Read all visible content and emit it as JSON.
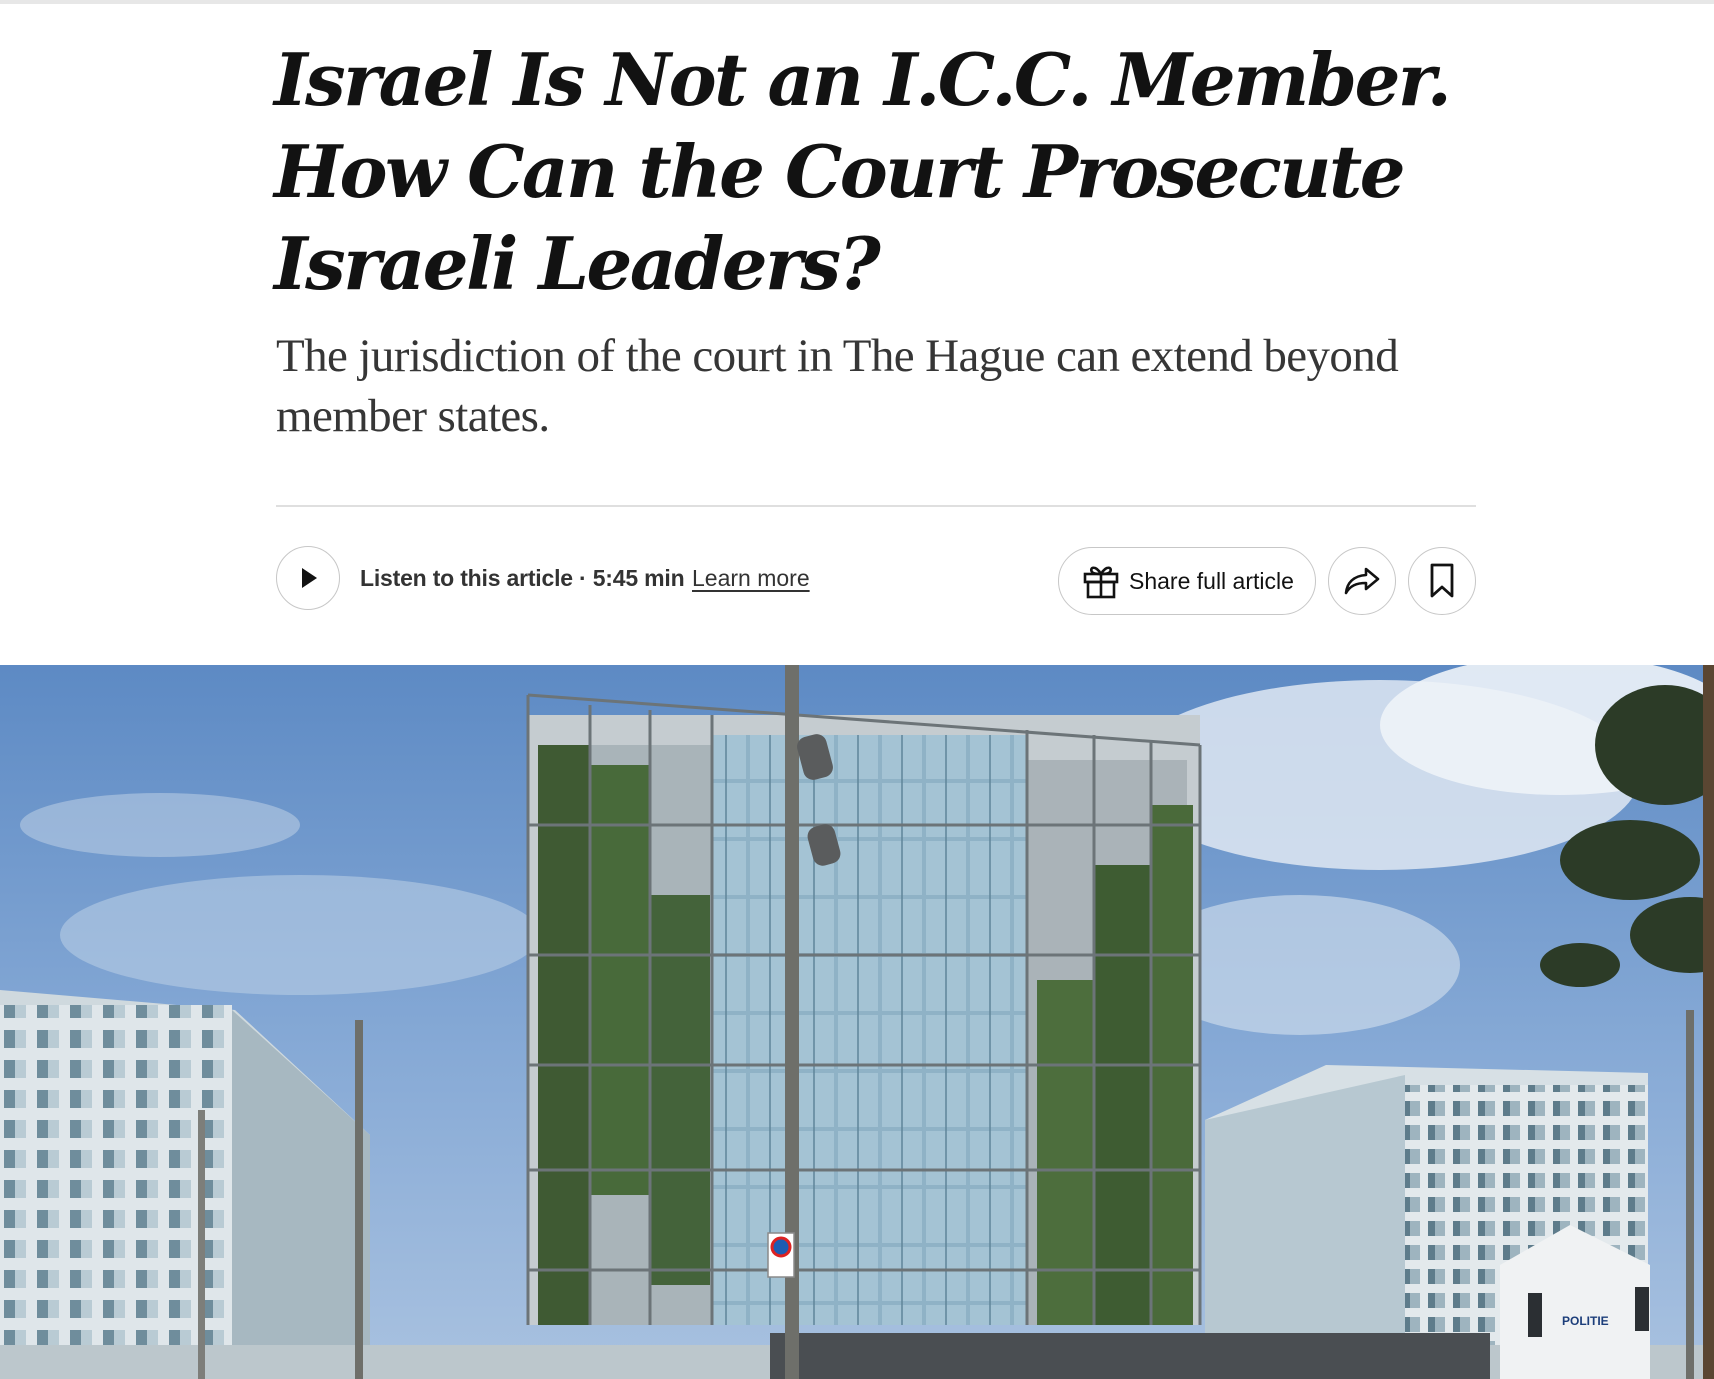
{
  "article": {
    "headline": "Israel Is Not an I.C.C. Member. How Can the Court Prosecute Israeli Leaders?",
    "summary": "The jurisdiction of the court in The Hague can extend beyond member states."
  },
  "toolbar": {
    "listen_label": "Listen to this article · 5:45 min",
    "learn_more": "Learn more",
    "share_full_article": "Share full article",
    "icons": [
      "play-icon",
      "gift-icon",
      "share-arrow-icon",
      "bookmark-icon"
    ]
  },
  "hero_image": {
    "description_tag": "building-photo",
    "sign_text": "POLITIE"
  },
  "colors": {
    "text_primary": "#121212",
    "text_secondary": "#363636",
    "border": "#c7c7c7",
    "divider": "#dfdfdf"
  }
}
